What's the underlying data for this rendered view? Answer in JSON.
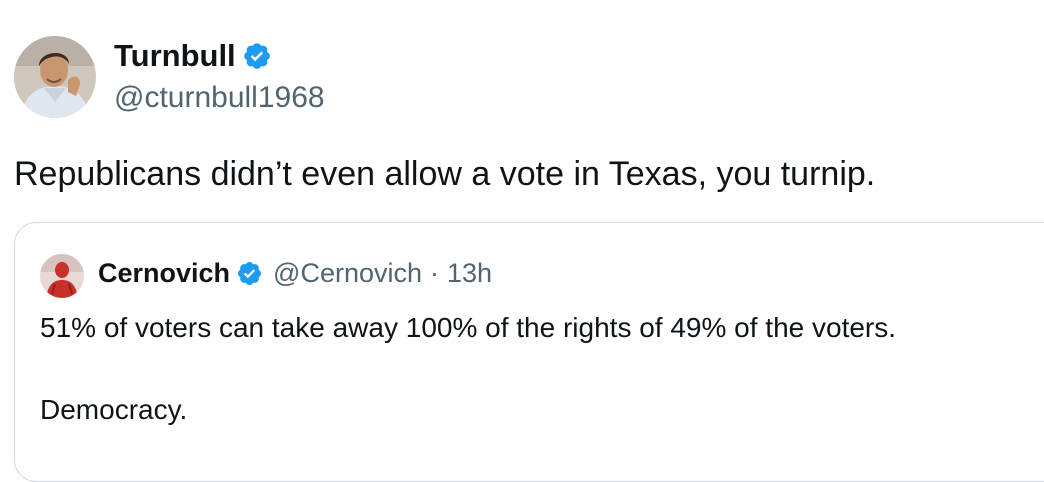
{
  "tweet": {
    "author": {
      "display_name": "Turnbull",
      "handle": "@cturnbull1968",
      "verified_icon": "verified-badge-icon"
    },
    "text": "Republicans didn’t even allow a vote in Texas, you turnip."
  },
  "quoted_tweet": {
    "author": {
      "display_name": "Cernovich",
      "handle": "@Cernovich",
      "verified_icon": "verified-badge-icon"
    },
    "separator": "·",
    "time": "13h",
    "text_line1": "51% of voters can take away 100% of the rights of 49% of the voters.",
    "text_line2": "Democracy."
  },
  "colors": {
    "verified_blue": "#1d9bf0",
    "text_primary": "#0f1419",
    "text_secondary": "#536471",
    "border": "#cfd9de"
  }
}
